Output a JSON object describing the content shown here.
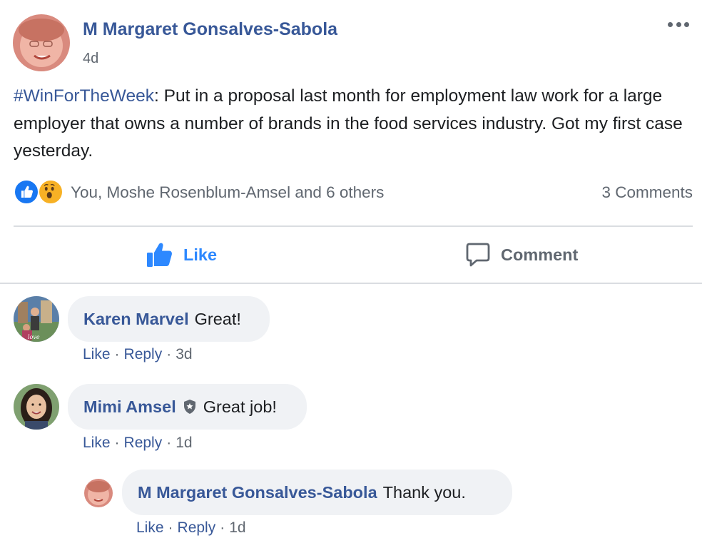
{
  "post": {
    "author": "M Margaret Gonsalves-Sabola",
    "time": "4d",
    "hashtag": "#WinForTheWeek",
    "text": ": Put in a proposal last month for employment law work for a large employer that owns a number of brands in the food services industry. Got my first case yesterday.",
    "more_icon": "ellipsis-icon"
  },
  "reactions": {
    "icons": [
      "like-icon",
      "wow-icon"
    ],
    "names": "You, Moshe Rosenblum-Amsel and 6 others",
    "comments_count": "3 Comments"
  },
  "actions": {
    "like_label": "Like",
    "comment_label": "Comment"
  },
  "comments": [
    {
      "name": "Karen Marvel",
      "text": "Great!",
      "like": "Like",
      "reply": "Reply",
      "time": "3d"
    },
    {
      "name": "Mimi Amsel",
      "badge": "admin-shield-icon",
      "text": "Great job!",
      "like": "Like",
      "reply": "Reply",
      "time": "1d"
    },
    {
      "name": "M Margaret Gonsalves-Sabola",
      "text": "Thank you.",
      "like": "Like",
      "reply": "Reply",
      "time": "1d"
    }
  ],
  "colors": {
    "link_blue": "#385898",
    "action_blue": "#2d88ff",
    "secondary_text": "#606770",
    "bubble_bg": "#f0f2f5",
    "divider": "#dadde1"
  }
}
